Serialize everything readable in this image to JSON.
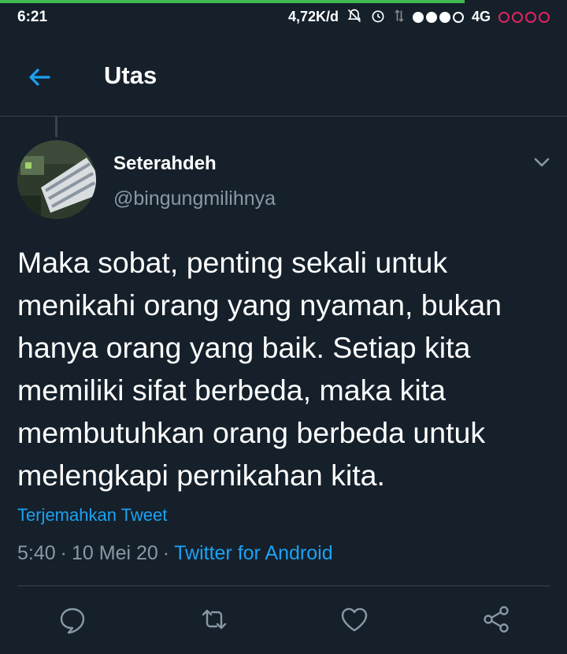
{
  "status_bar": {
    "time": "6:21",
    "speed": "4,72K/d",
    "network": "4G",
    "download_progress": 0.82,
    "colors": {
      "progress": "#3fb950",
      "no_sim": "#e0245e"
    }
  },
  "header": {
    "back_icon": "arrow-left-icon",
    "title": "Utas"
  },
  "tweet": {
    "display_name": "Seterahdeh",
    "handle": "@bingungmilihnya",
    "text": "Maka sobat, penting sekali untuk\nmenikahi orang yang nyaman, bukan\nhanya orang yang baik. Setiap kita\nmemiliki sifat berbeda, maka kita\nmembutuhkan orang berbeda untuk\nmelengkapi pernikahan kita.",
    "translate_label": "Terjemahkan Tweet",
    "time": "5:40",
    "date": "10 Mei 20",
    "separator": "·",
    "source": "Twitter for Android"
  },
  "actions": [
    "reply-icon",
    "retweet-icon",
    "like-icon",
    "share-icon"
  ],
  "colors": {
    "background": "#15202b",
    "accent": "#1da1f2",
    "muted": "#8899a6",
    "divider": "#38444d"
  }
}
